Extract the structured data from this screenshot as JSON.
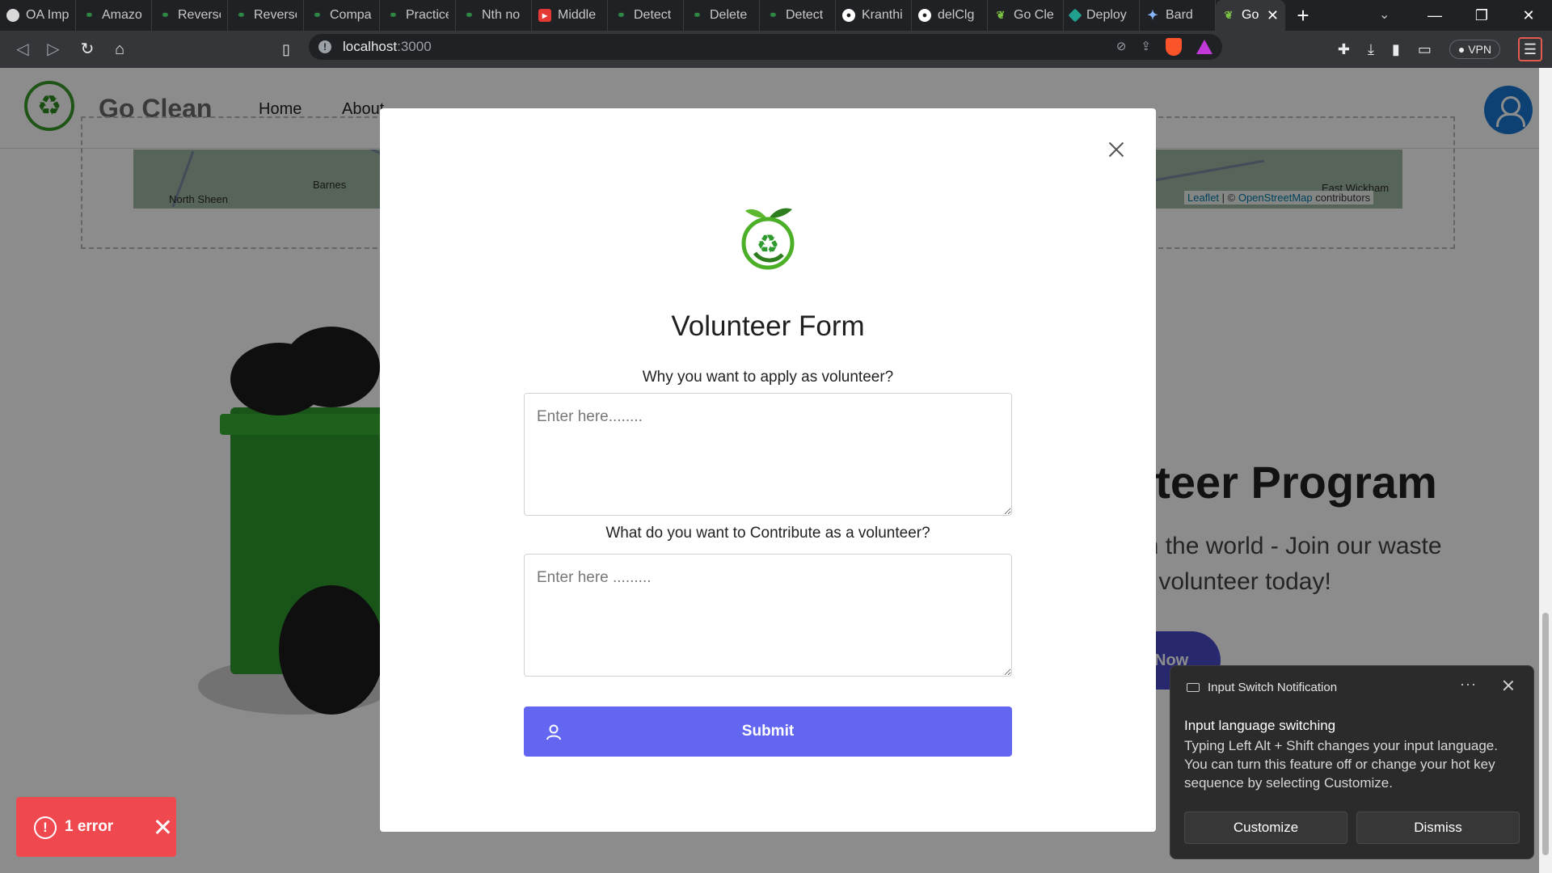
{
  "browser": {
    "tabs": [
      {
        "label": "OA Imp",
        "icon": "openai-icon"
      },
      {
        "label": "Amazo",
        "icon": "gfg-icon"
      },
      {
        "label": "Reverse",
        "icon": "gfg-icon"
      },
      {
        "label": "Reverse",
        "icon": "gfg-icon"
      },
      {
        "label": "Compa",
        "icon": "gfg-icon"
      },
      {
        "label": "Practice",
        "icon": "gfg-icon"
      },
      {
        "label": "Nth no",
        "icon": "gfg-icon"
      },
      {
        "label": "Middle",
        "icon": "youtube-icon"
      },
      {
        "label": "Detect",
        "icon": "gfg-icon"
      },
      {
        "label": "Delete",
        "icon": "gfg-icon"
      },
      {
        "label": "Detect",
        "icon": "gfg-icon"
      },
      {
        "label": "Kranthi",
        "icon": "github-icon"
      },
      {
        "label": "delClg",
        "icon": "github-icon"
      },
      {
        "label": "Go Cle",
        "icon": "leaf-icon"
      },
      {
        "label": "Deploy",
        "icon": "deploy-icon"
      },
      {
        "label": "Bard",
        "icon": "bard-icon"
      }
    ],
    "active_tab": "Go",
    "address": {
      "host": "localhost",
      "port": ":3000"
    },
    "vpn_label": "VPN"
  },
  "site": {
    "brand": "Go Clean",
    "nav": [
      "Home",
      "About"
    ],
    "map": {
      "labels": [
        "North Sheen",
        "Barnes",
        "East Wickham"
      ],
      "attribution_leaflet": "Leaflet",
      "attribution_sep": " | © ",
      "attribution_osm": "OpenStreetMap",
      "attribution_tail": " contributors"
    },
    "hero_title": "nteer Program",
    "hero_sub_1": "e in the world - Join our waste",
    "hero_sub_2": "s a volunteer today!",
    "hero_button": "Now"
  },
  "modal": {
    "title": "Volunteer Form",
    "question_1": "Why you want to apply as volunteer?",
    "placeholder_1": "Enter here........",
    "question_2": "What do you want to Contribute as a volunteer?",
    "placeholder_2": "Enter here .........",
    "submit_label": "Submit"
  },
  "error_toast": {
    "text": "1 error"
  },
  "notification": {
    "app": "Input Switch Notification",
    "title": "Input language switching",
    "body": "Typing Left Alt + Shift changes your input language. You can turn this feature off or change your hot key sequence by selecting Customize.",
    "customize": "Customize",
    "dismiss": "Dismiss"
  },
  "colors": {
    "accent": "#6366f1",
    "error": "#f0484f",
    "brand_green": "#3a9a2a"
  }
}
